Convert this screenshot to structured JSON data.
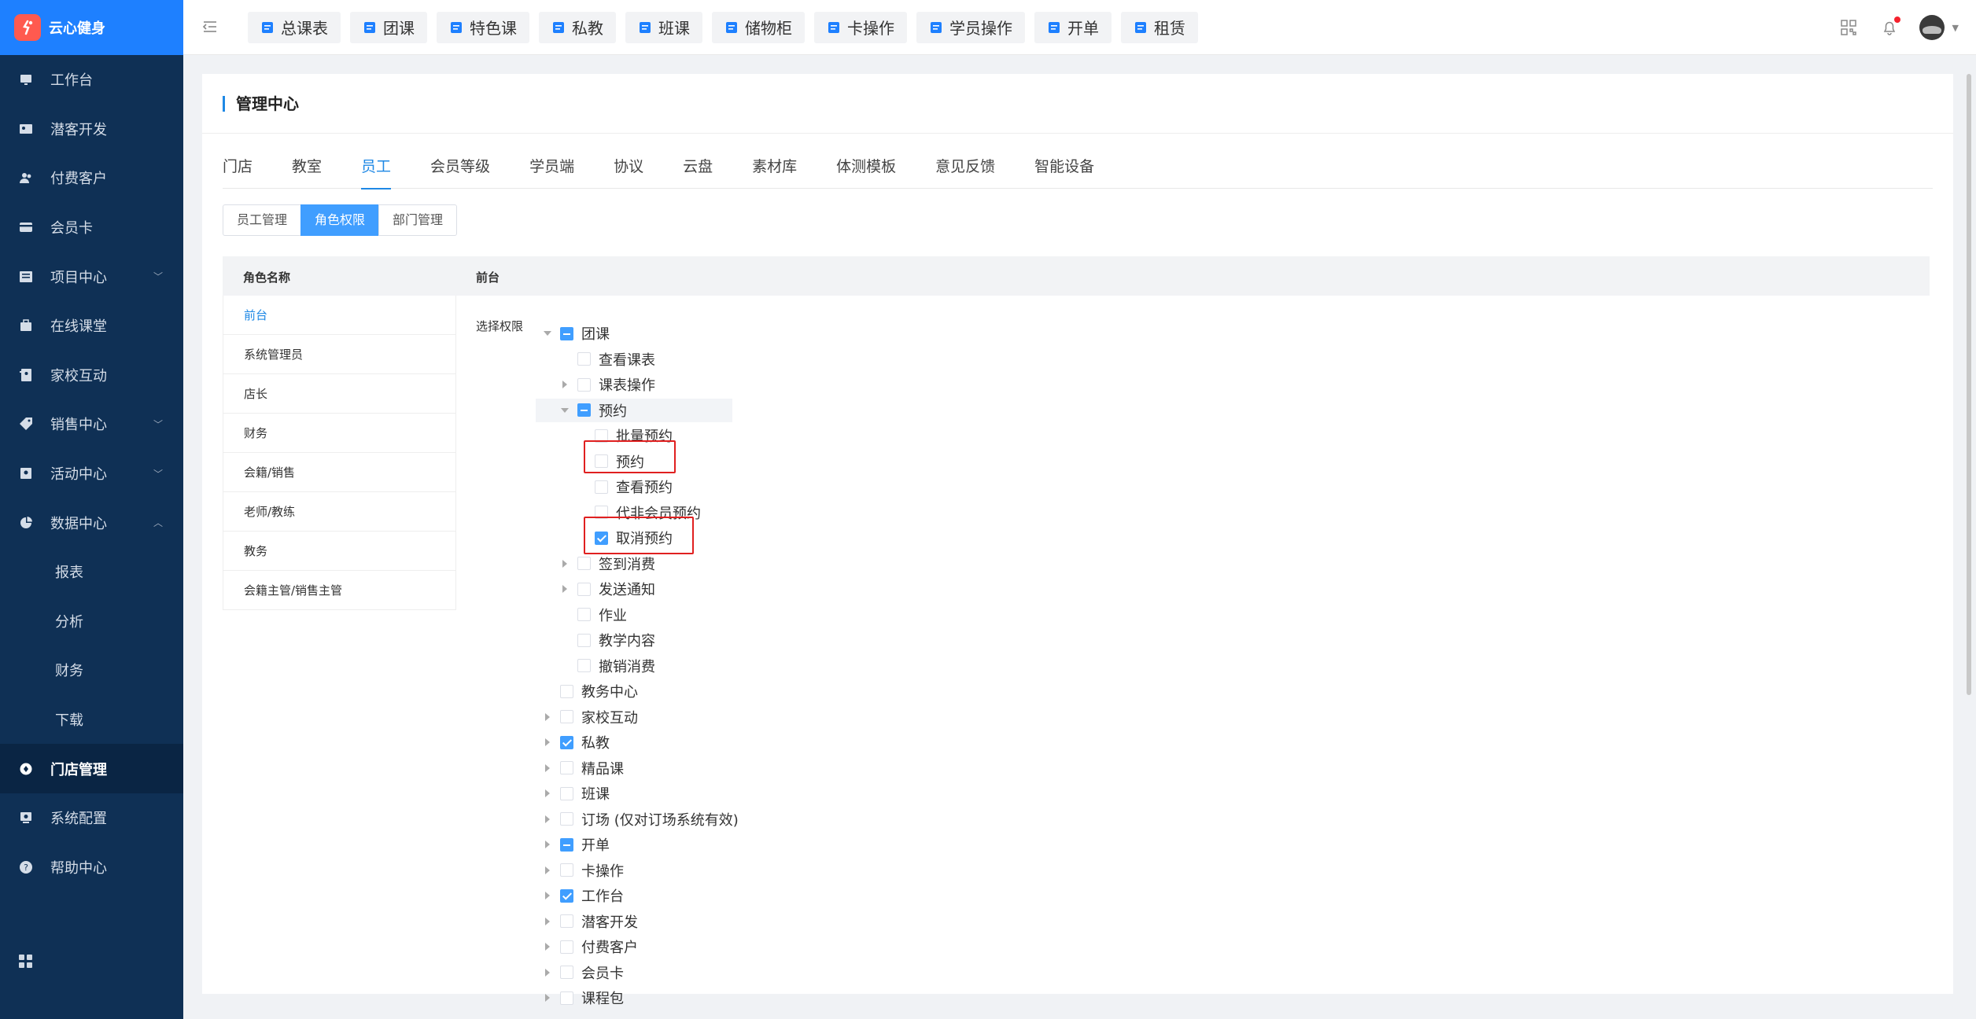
{
  "app": {
    "name": "云心健身"
  },
  "sidebar": {
    "items": [
      {
        "label": "工作台",
        "icon": "monitor-icon"
      },
      {
        "label": "潜客开发",
        "icon": "idcard-icon"
      },
      {
        "label": "付费客户",
        "icon": "users-icon"
      },
      {
        "label": "会员卡",
        "icon": "card-icon"
      },
      {
        "label": "项目中心",
        "icon": "list-icon",
        "expandable": true
      },
      {
        "label": "在线课堂",
        "icon": "bag-icon"
      },
      {
        "label": "家校互动",
        "icon": "contact-icon"
      },
      {
        "label": "销售中心",
        "icon": "tag-icon",
        "expandable": true
      },
      {
        "label": "活动中心",
        "icon": "activity-icon",
        "expandable": true
      },
      {
        "label": "数据中心",
        "icon": "pie-icon",
        "expanded": true
      }
    ],
    "sub_items": [
      "报表",
      "分析",
      "财务",
      "下载"
    ],
    "bottom_items": [
      {
        "label": "门店管理",
        "icon": "store-icon",
        "active": true
      },
      {
        "label": "系统配置",
        "icon": "settings-icon"
      },
      {
        "label": "帮助中心",
        "icon": "help-icon"
      }
    ]
  },
  "topbar": {
    "quick": [
      "总课表",
      "团课",
      "特色课",
      "私教",
      "班课",
      "储物柜",
      "卡操作",
      "学员操作",
      "开单",
      "租赁"
    ]
  },
  "panel": {
    "title": "管理中心",
    "tabs": [
      "门店",
      "教室",
      "员工",
      "会员等级",
      "学员端",
      "协议",
      "云盘",
      "素材库",
      "体测模板",
      "意见反馈",
      "智能设备"
    ],
    "active_tab": "员工",
    "segments": [
      "员工管理",
      "角色权限",
      "部门管理"
    ],
    "active_segment": "角色权限",
    "table": {
      "col_role": "角色名称",
      "col_perm": "前台"
    },
    "roles": [
      "前台",
      "系统管理员",
      "店长",
      "财务",
      "会籍/销售",
      "老师/教练",
      "教务",
      "会籍主管/销售主管"
    ],
    "active_role": "前台",
    "perm_label": "选择权限",
    "tree": [
      {
        "label": "团课",
        "level": 0,
        "arrow": "down",
        "state": "indeterminate"
      },
      {
        "label": "查看课表",
        "level": 1,
        "arrow": "",
        "state": "unchecked"
      },
      {
        "label": "课表操作",
        "level": 1,
        "arrow": "right",
        "state": "unchecked"
      },
      {
        "label": "预约",
        "level": 1,
        "arrow": "down",
        "state": "indeterminate",
        "highlight": true
      },
      {
        "label": "批量预约",
        "level": 2,
        "arrow": "",
        "state": "unchecked"
      },
      {
        "label": "预约",
        "level": 2,
        "arrow": "",
        "state": "unchecked",
        "boxed": true
      },
      {
        "label": "查看预约",
        "level": 2,
        "arrow": "",
        "state": "unchecked"
      },
      {
        "label": "代非会员预约",
        "level": 2,
        "arrow": "",
        "state": "unchecked"
      },
      {
        "label": "取消预约",
        "level": 2,
        "arrow": "",
        "state": "checked",
        "boxed": true
      },
      {
        "label": "签到消费",
        "level": 1,
        "arrow": "right",
        "state": "unchecked"
      },
      {
        "label": "发送通知",
        "level": 1,
        "arrow": "right",
        "state": "unchecked"
      },
      {
        "label": "作业",
        "level": 1,
        "arrow": "",
        "state": "unchecked"
      },
      {
        "label": "教学内容",
        "level": 1,
        "arrow": "",
        "state": "unchecked"
      },
      {
        "label": "撤销消费",
        "level": 1,
        "arrow": "",
        "state": "unchecked"
      },
      {
        "label": "教务中心",
        "level": 0,
        "arrow": "",
        "state": "unchecked"
      },
      {
        "label": "家校互动",
        "level": 0,
        "arrow": "right",
        "state": "unchecked"
      },
      {
        "label": "私教",
        "level": 0,
        "arrow": "right",
        "state": "checked"
      },
      {
        "label": "精品课",
        "level": 0,
        "arrow": "right",
        "state": "unchecked"
      },
      {
        "label": "班课",
        "level": 0,
        "arrow": "right",
        "state": "unchecked"
      },
      {
        "label": "订场 (仅对订场系统有效)",
        "level": 0,
        "arrow": "right",
        "state": "unchecked"
      },
      {
        "label": "开单",
        "level": 0,
        "arrow": "right",
        "state": "indeterminate"
      },
      {
        "label": "卡操作",
        "level": 0,
        "arrow": "right",
        "state": "unchecked"
      },
      {
        "label": "工作台",
        "level": 0,
        "arrow": "right",
        "state": "checked"
      },
      {
        "label": "潜客开发",
        "level": 0,
        "arrow": "right",
        "state": "unchecked"
      },
      {
        "label": "付费客户",
        "level": 0,
        "arrow": "right",
        "state": "unchecked"
      },
      {
        "label": "会员卡",
        "level": 0,
        "arrow": "right",
        "state": "unchecked"
      },
      {
        "label": "课程包",
        "level": 0,
        "arrow": "right",
        "state": "unchecked"
      }
    ]
  },
  "colors": {
    "sidebar_bg": "#0f3055",
    "logo_bg": "#1e80ff",
    "accent": "#409eff",
    "highlight_box": "#e02020"
  }
}
